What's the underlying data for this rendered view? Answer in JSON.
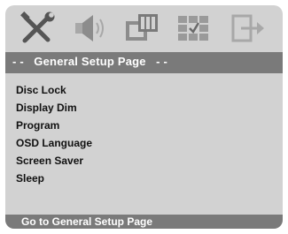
{
  "toolbar": {
    "icons": [
      {
        "name": "general-setup-icon"
      },
      {
        "name": "audio-setup-icon"
      },
      {
        "name": "video-setup-icon"
      },
      {
        "name": "preference-setup-icon"
      },
      {
        "name": "exit-icon"
      }
    ]
  },
  "header": {
    "title": "- -   General Setup Page   - -"
  },
  "menu": {
    "items": [
      {
        "label": "Disc Lock"
      },
      {
        "label": "Display Dim"
      },
      {
        "label": "Program"
      },
      {
        "label": "OSD Language"
      },
      {
        "label": "Screen Saver"
      },
      {
        "label": "Sleep"
      }
    ]
  },
  "status": {
    "text": "Go to General Setup Page"
  }
}
